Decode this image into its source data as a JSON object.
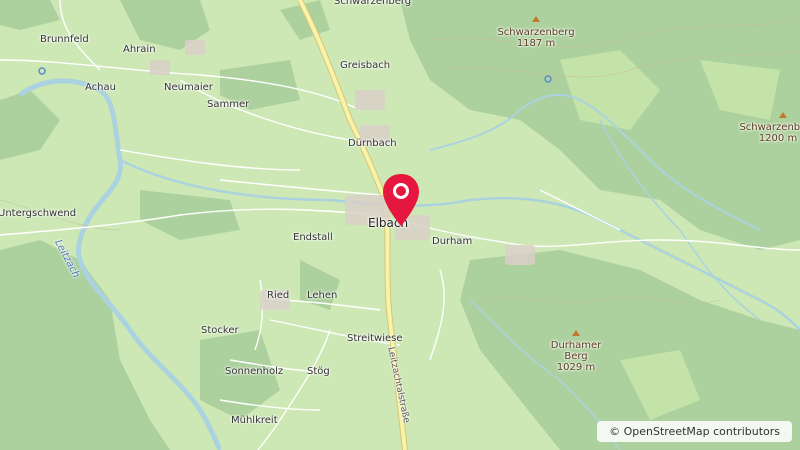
{
  "map": {
    "places": {
      "schwarzenberg_village": "Schwarzenberg",
      "brunnfeld": "Brunnfeld",
      "ahrain": "Ahrain",
      "achau": "Achau",
      "neumaier": "Neumaier",
      "sammer": "Sammer",
      "greisbach": "Greisbach",
      "duernbach": "Dürnbach",
      "untergschwend": "Untergschwend",
      "elbach": "Elbach",
      "durham": "Durham",
      "endstall": "Endstall",
      "ried": "Ried",
      "lehen": "Lehen",
      "stocker": "Stocker",
      "streitwiese": "Streitwiese",
      "sonnenholz": "Sonnenholz",
      "stoeg": "Stög",
      "muehlkreit": "Mühlkreit"
    },
    "peaks": {
      "schwarzenberg_1": {
        "name": "Schwarzenberg",
        "elevation": "1187 m"
      },
      "schwarzenberg_2": {
        "name": "Schwarzenberg",
        "elevation": "1200 m"
      },
      "durhamer_berg": {
        "name_line1": "Durhamer",
        "name_line2": "Berg",
        "elevation": "1029 m"
      }
    },
    "water": {
      "leitzach": "Leitzach"
    },
    "roads": {
      "leitzachtalstrasse": "Leitzachtalstraße"
    },
    "marker_icon": "map-pin-icon",
    "colors": {
      "forest": "#add19e",
      "meadow": "#cde8b4",
      "water": "#aad3df",
      "road_major": "#f7f3a8",
      "marker": "#e6173e"
    }
  },
  "attribution": {
    "symbol": "©",
    "text": "OpenStreetMap contributors"
  }
}
